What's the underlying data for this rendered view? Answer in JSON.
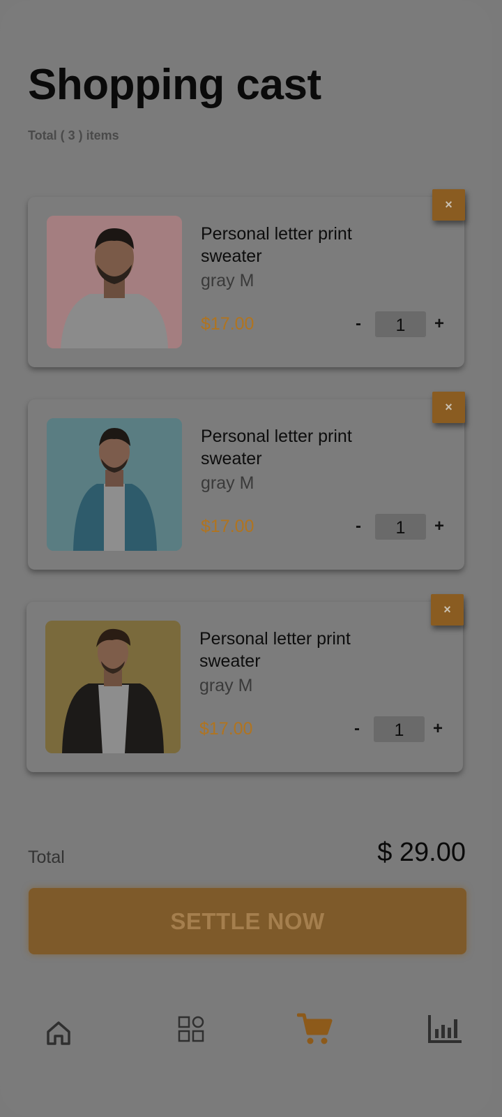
{
  "header": {
    "title": "Shopping cast",
    "subtitle": "Total  ( 3 ) items"
  },
  "cart": {
    "items": [
      {
        "name": "Personal letter print sweater",
        "variant": "gray M",
        "price": "$17.00",
        "quantity": "1",
        "remove": "×",
        "minus": "-",
        "plus": "+",
        "image_bg": "#a47e80"
      },
      {
        "name": "Personal letter print sweater",
        "variant": "gray M",
        "price": "$17.00",
        "quantity": "1",
        "remove": "×",
        "minus": "-",
        "plus": "+",
        "image_bg": "#5a7d82"
      },
      {
        "name": "Personal letter print sweater",
        "variant": "gray M",
        "price": "$17.00",
        "quantity": "1",
        "remove": "×",
        "minus": "-",
        "plus": "+",
        "image_bg": "#7a6a3c"
      }
    ]
  },
  "summary": {
    "total_label": "Total",
    "total_value": "$ 29.00",
    "settle_label": "SETTLE NOW"
  },
  "tabbar": {
    "items": [
      "home-icon",
      "grid-icon",
      "cart-icon",
      "chart-icon"
    ],
    "active": "cart-icon"
  },
  "colors": {
    "accent": "#b07420",
    "overlay_bg": "#7b7b7b"
  }
}
